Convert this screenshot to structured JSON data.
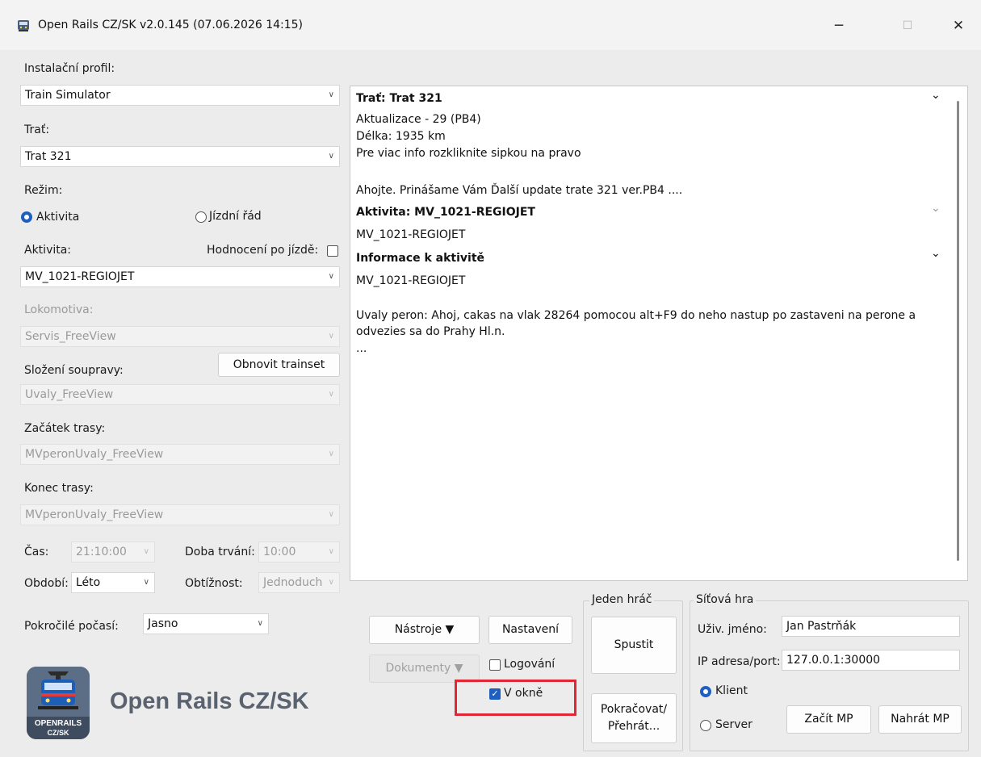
{
  "window": {
    "title": "Open Rails CZ/SK v2.0.145 (07.06.2026 14:15)",
    "minimize_glyph": "─",
    "maximize_glyph": "☐",
    "close_glyph": "✕",
    "app_icon": "train-icon"
  },
  "left": {
    "install_profile_label": "Instalační profil:",
    "install_profile_value": "Train Simulator",
    "route_label": "Trať:",
    "route_value": "Trat 321",
    "mode_label": "Režim:",
    "mode_activity": "Aktivita",
    "mode_timetable": "Jízdní řád",
    "activity_label": "Aktivita:",
    "rating_label": "Hodnocení po jízdě:",
    "activity_value": "MV_1021-REGIOJET",
    "locomotive_label": "Lokomotiva:",
    "locomotive_value": "Servis_FreeView",
    "consist_label": "Složení soupravy:",
    "refresh_trainset": "Obnovit trainset",
    "consist_value": "Uvaly_FreeView",
    "path_start_label": "Začátek trasy:",
    "path_start_value": "MVperonUvaly_FreeView",
    "path_end_label": "Konec trasy:",
    "path_end_value": "MVperonUvaly_FreeView",
    "time_label": "Čas:",
    "time_value": "21:10:00",
    "duration_label": "Doba trvání:",
    "duration_value": "10:00",
    "season_label": "Období:",
    "season_value": "Léto",
    "difficulty_label": "Obtížnost:",
    "difficulty_value": "Jednoduch",
    "weather_label": "Pokročilé počasí:",
    "weather_value": "Jasno"
  },
  "details": {
    "route_heading": "Trať: Trat 321",
    "route_line1": "Aktualizace - 29 (PB4)",
    "route_line2": "Délka:  1935 km",
    "route_line3": "Pre viac info rozkliknite sipkou na pravo",
    "route_line4": "Ahojte. Prinášame Vám Ďalší update trate 321 ver.PB4 ....",
    "activity_heading": "Aktivita: MV_1021-REGIOJET",
    "activity_line1": "MV_1021-REGIOJET",
    "info_heading": "Informace k aktivitě",
    "info_line1": "MV_1021-REGIOJET",
    "info_line2": "Uvaly peron: Ahoj, cakas na vlak 28264 pomocou alt+F9 do neho nastup po zastaveni na perone a",
    "info_line3": "odvezies sa do Prahy Hl.n.",
    "info_line4": "..."
  },
  "tools": {
    "tools_button": "Nástroje ▼",
    "settings_button": "Nastavení",
    "documents_button": "Dokumenty ▼",
    "logging_label": "Logování",
    "windowed_label": "V okně"
  },
  "single": {
    "group_title": "Jeden hráč",
    "start_button": "Spustit",
    "resume_line1": "Pokračovat/",
    "resume_line2": "Přehrát..."
  },
  "multi": {
    "group_title": "Síťová hra",
    "username_label": "Uživ. jméno:",
    "username_value": "Jan Pastrňák",
    "host_label": "IP adresa/port:",
    "host_value": "127.0.0.1:30000",
    "client_label": "Klient",
    "server_label": "Server",
    "start_mp_button": "Začít MP",
    "resume_mp_button": "Nahrát MP"
  },
  "logo": {
    "badge_line1": "OPENRAILS",
    "badge_line2": "CZ/SK",
    "brand_text": "Open Rails CZ/SK"
  },
  "colors": {
    "accent": "#1f5fbf",
    "highlight": "#e32636"
  }
}
